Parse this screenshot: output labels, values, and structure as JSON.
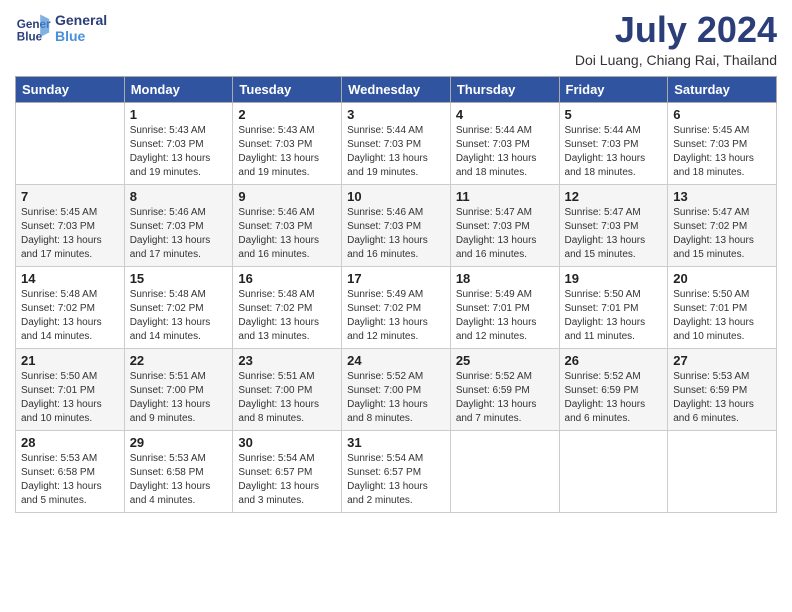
{
  "header": {
    "logo_line1": "General",
    "logo_line2": "Blue",
    "month_title": "July 2024",
    "location": "Doi Luang, Chiang Rai, Thailand"
  },
  "weekdays": [
    "Sunday",
    "Monday",
    "Tuesday",
    "Wednesday",
    "Thursday",
    "Friday",
    "Saturday"
  ],
  "weeks": [
    [
      {
        "day": "",
        "info": ""
      },
      {
        "day": "1",
        "info": "Sunrise: 5:43 AM\nSunset: 7:03 PM\nDaylight: 13 hours\nand 19 minutes."
      },
      {
        "day": "2",
        "info": "Sunrise: 5:43 AM\nSunset: 7:03 PM\nDaylight: 13 hours\nand 19 minutes."
      },
      {
        "day": "3",
        "info": "Sunrise: 5:44 AM\nSunset: 7:03 PM\nDaylight: 13 hours\nand 19 minutes."
      },
      {
        "day": "4",
        "info": "Sunrise: 5:44 AM\nSunset: 7:03 PM\nDaylight: 13 hours\nand 18 minutes."
      },
      {
        "day": "5",
        "info": "Sunrise: 5:44 AM\nSunset: 7:03 PM\nDaylight: 13 hours\nand 18 minutes."
      },
      {
        "day": "6",
        "info": "Sunrise: 5:45 AM\nSunset: 7:03 PM\nDaylight: 13 hours\nand 18 minutes."
      }
    ],
    [
      {
        "day": "7",
        "info": "Sunrise: 5:45 AM\nSunset: 7:03 PM\nDaylight: 13 hours\nand 17 minutes."
      },
      {
        "day": "8",
        "info": "Sunrise: 5:46 AM\nSunset: 7:03 PM\nDaylight: 13 hours\nand 17 minutes."
      },
      {
        "day": "9",
        "info": "Sunrise: 5:46 AM\nSunset: 7:03 PM\nDaylight: 13 hours\nand 16 minutes."
      },
      {
        "day": "10",
        "info": "Sunrise: 5:46 AM\nSunset: 7:03 PM\nDaylight: 13 hours\nand 16 minutes."
      },
      {
        "day": "11",
        "info": "Sunrise: 5:47 AM\nSunset: 7:03 PM\nDaylight: 13 hours\nand 16 minutes."
      },
      {
        "day": "12",
        "info": "Sunrise: 5:47 AM\nSunset: 7:03 PM\nDaylight: 13 hours\nand 15 minutes."
      },
      {
        "day": "13",
        "info": "Sunrise: 5:47 AM\nSunset: 7:02 PM\nDaylight: 13 hours\nand 15 minutes."
      }
    ],
    [
      {
        "day": "14",
        "info": "Sunrise: 5:48 AM\nSunset: 7:02 PM\nDaylight: 13 hours\nand 14 minutes."
      },
      {
        "day": "15",
        "info": "Sunrise: 5:48 AM\nSunset: 7:02 PM\nDaylight: 13 hours\nand 14 minutes."
      },
      {
        "day": "16",
        "info": "Sunrise: 5:48 AM\nSunset: 7:02 PM\nDaylight: 13 hours\nand 13 minutes."
      },
      {
        "day": "17",
        "info": "Sunrise: 5:49 AM\nSunset: 7:02 PM\nDaylight: 13 hours\nand 12 minutes."
      },
      {
        "day": "18",
        "info": "Sunrise: 5:49 AM\nSunset: 7:01 PM\nDaylight: 13 hours\nand 12 minutes."
      },
      {
        "day": "19",
        "info": "Sunrise: 5:50 AM\nSunset: 7:01 PM\nDaylight: 13 hours\nand 11 minutes."
      },
      {
        "day": "20",
        "info": "Sunrise: 5:50 AM\nSunset: 7:01 PM\nDaylight: 13 hours\nand 10 minutes."
      }
    ],
    [
      {
        "day": "21",
        "info": "Sunrise: 5:50 AM\nSunset: 7:01 PM\nDaylight: 13 hours\nand 10 minutes."
      },
      {
        "day": "22",
        "info": "Sunrise: 5:51 AM\nSunset: 7:00 PM\nDaylight: 13 hours\nand 9 minutes."
      },
      {
        "day": "23",
        "info": "Sunrise: 5:51 AM\nSunset: 7:00 PM\nDaylight: 13 hours\nand 8 minutes."
      },
      {
        "day": "24",
        "info": "Sunrise: 5:52 AM\nSunset: 7:00 PM\nDaylight: 13 hours\nand 8 minutes."
      },
      {
        "day": "25",
        "info": "Sunrise: 5:52 AM\nSunset: 6:59 PM\nDaylight: 13 hours\nand 7 minutes."
      },
      {
        "day": "26",
        "info": "Sunrise: 5:52 AM\nSunset: 6:59 PM\nDaylight: 13 hours\nand 6 minutes."
      },
      {
        "day": "27",
        "info": "Sunrise: 5:53 AM\nSunset: 6:59 PM\nDaylight: 13 hours\nand 6 minutes."
      }
    ],
    [
      {
        "day": "28",
        "info": "Sunrise: 5:53 AM\nSunset: 6:58 PM\nDaylight: 13 hours\nand 5 minutes."
      },
      {
        "day": "29",
        "info": "Sunrise: 5:53 AM\nSunset: 6:58 PM\nDaylight: 13 hours\nand 4 minutes."
      },
      {
        "day": "30",
        "info": "Sunrise: 5:54 AM\nSunset: 6:57 PM\nDaylight: 13 hours\nand 3 minutes."
      },
      {
        "day": "31",
        "info": "Sunrise: 5:54 AM\nSunset: 6:57 PM\nDaylight: 13 hours\nand 2 minutes."
      },
      {
        "day": "",
        "info": ""
      },
      {
        "day": "",
        "info": ""
      },
      {
        "day": "",
        "info": ""
      }
    ]
  ]
}
